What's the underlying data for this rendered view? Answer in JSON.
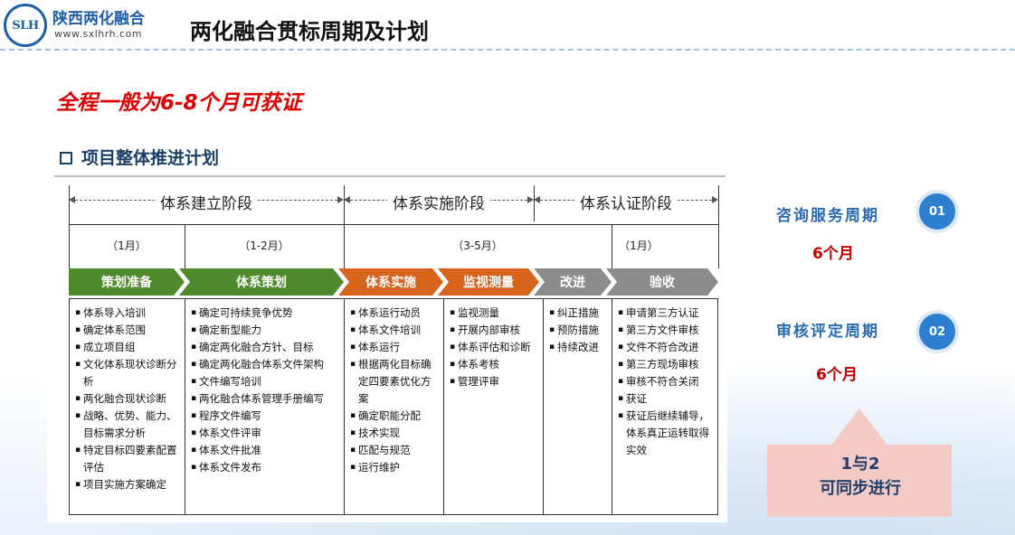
{
  "header": {
    "logo_name": "陕西两化融合",
    "logo_url": "www.sxlhrh.com",
    "logo_mark": "SLH",
    "title": "两化融合贯标周期及计划"
  },
  "subtitle": "全程一般为6-8个月可获证",
  "plan": {
    "heading": "项目整体推进计划",
    "phases": [
      "体系建立阶段",
      "体系实施阶段",
      "体系认证阶段"
    ],
    "months": [
      "（1月）",
      "（1-2月）",
      "（3-5月）",
      "（1月）"
    ],
    "steps": [
      "策划准备",
      "体系策划",
      "体系实施",
      "监视测量",
      "改进",
      "验收"
    ],
    "columns": [
      [
        "体系导入培训",
        "确定体系范围",
        "成立项目组",
        "文化体系现状诊断分析",
        "两化融合现状诊断",
        "战略、优势、能力、目标需求分析",
        "特定目标四要素配置评估",
        "项目实施方案确定"
      ],
      [
        "确定可持续竞争优势",
        "确定新型能力",
        "确定两化融合方针、目标",
        "确定两化融合体系文件架构",
        "文件编写培训",
        "两化融合体系管理手册编写",
        "程序文件编写",
        "体系文件评审",
        "体系文件批准",
        "体系文件发布"
      ],
      [
        "体系运行动员",
        "体系文件培训",
        "体系运行",
        "根据两化目标确定四要素优化方案",
        "确定职能分配",
        "技术实现",
        "匹配与规范",
        "运行维护"
      ],
      [
        "监视测量",
        "开展内部审核",
        "体系评估和诊断",
        "体系考核",
        "管理评审"
      ],
      [
        "纠正措施",
        "预防措施",
        "持续改进"
      ],
      [
        "申请第三方认证",
        "第三方文件审核",
        "文件不符合改进",
        "第三方现场审核",
        "审核不符合关闭",
        "获证",
        "获证后继续辅导，体系真正运转取得实效"
      ]
    ]
  },
  "side": {
    "items": [
      {
        "label": "咨询服务周期",
        "num": "01",
        "value": "6个月"
      },
      {
        "label": "审核评定周期",
        "num": "02",
        "value": "6个月"
      }
    ],
    "note_line1": "1与2",
    "note_line2": "可同步进行"
  }
}
